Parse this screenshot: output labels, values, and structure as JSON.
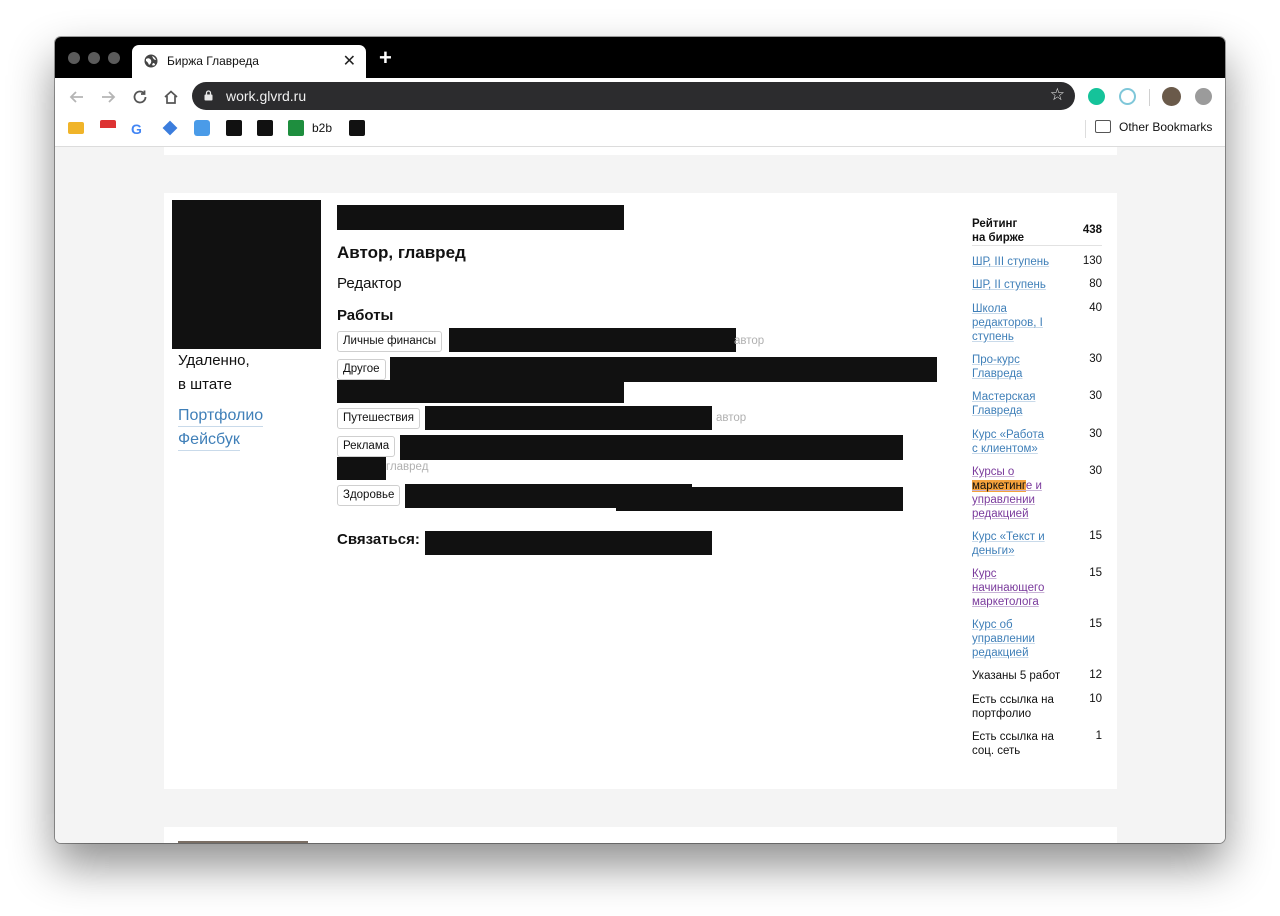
{
  "browser": {
    "tab_title": "Биржа Главреда",
    "close_glyph": "✕",
    "new_tab_glyph": "+",
    "url": "work.glvrd.ru",
    "bookmarks": [
      "b2b"
    ],
    "other_bookmarks": "Other Bookmarks",
    "icons": [
      "back-arrow-icon",
      "forward-arrow-icon",
      "reload-icon",
      "home-icon",
      "lock-icon",
      "star-icon",
      "grammarly-icon",
      "extension-icon",
      "profile-avatar-icon",
      "menu-icon"
    ]
  },
  "profile": {
    "role_title": "Автор, главред",
    "position": "Редактор",
    "location_line1": "Удаленно,",
    "location_line2": "в штате",
    "links": [
      "Портфолио",
      "Фейсбук"
    ],
    "works_heading": "Работы",
    "works": [
      {
        "category": "Личные финансы",
        "role": "автор"
      },
      {
        "category": "Другое",
        "role": ""
      },
      {
        "category": "Путешествия",
        "role": "автор"
      },
      {
        "category": "Реклама",
        "role": "главред"
      },
      {
        "category": "Здоровье",
        "role": ""
      }
    ],
    "contact_label": "Связаться:"
  },
  "rating": {
    "header_line1": "Рейтинг",
    "header_line2": "на бирже",
    "total": "438",
    "items": [
      {
        "label": "ШР, III ступень",
        "value": "130",
        "style": "link"
      },
      {
        "label": "ШР, II ступень",
        "value": "80",
        "style": "link"
      },
      {
        "label": "Школа редакторов, I ступень",
        "value": "40",
        "style": "link"
      },
      {
        "label": "Про-курс Главреда",
        "value": "30",
        "style": "link"
      },
      {
        "label": "Мастерская Главреда",
        "value": "30",
        "style": "link"
      },
      {
        "label": "Курс «Работа с клиентом»",
        "value": "30",
        "style": "link"
      },
      {
        "label_pre": "Курсы о ",
        "label_hl": "маркетинг",
        "label_post": "е и управлении редакцией",
        "value": "30",
        "style": "visited"
      },
      {
        "label": "Курс «Текст и деньги»",
        "value": "15",
        "style": "link"
      },
      {
        "label": "Курс начинающего маркетолога",
        "value": "15",
        "style": "visited"
      },
      {
        "label": "Курс об управлении редакцией",
        "value": "15",
        "style": "link"
      },
      {
        "label": "Указаны 5 работ",
        "value": "12",
        "style": "plain"
      },
      {
        "label": "Есть ссылка на портфолио",
        "value": "10",
        "style": "plain"
      },
      {
        "label": "Есть ссылка на соц. сеть",
        "value": "1",
        "style": "plain"
      }
    ]
  },
  "colors": {
    "link": "#3f7fb8",
    "visited": "#7a3a9c",
    "highlight": "#f5a23c"
  }
}
